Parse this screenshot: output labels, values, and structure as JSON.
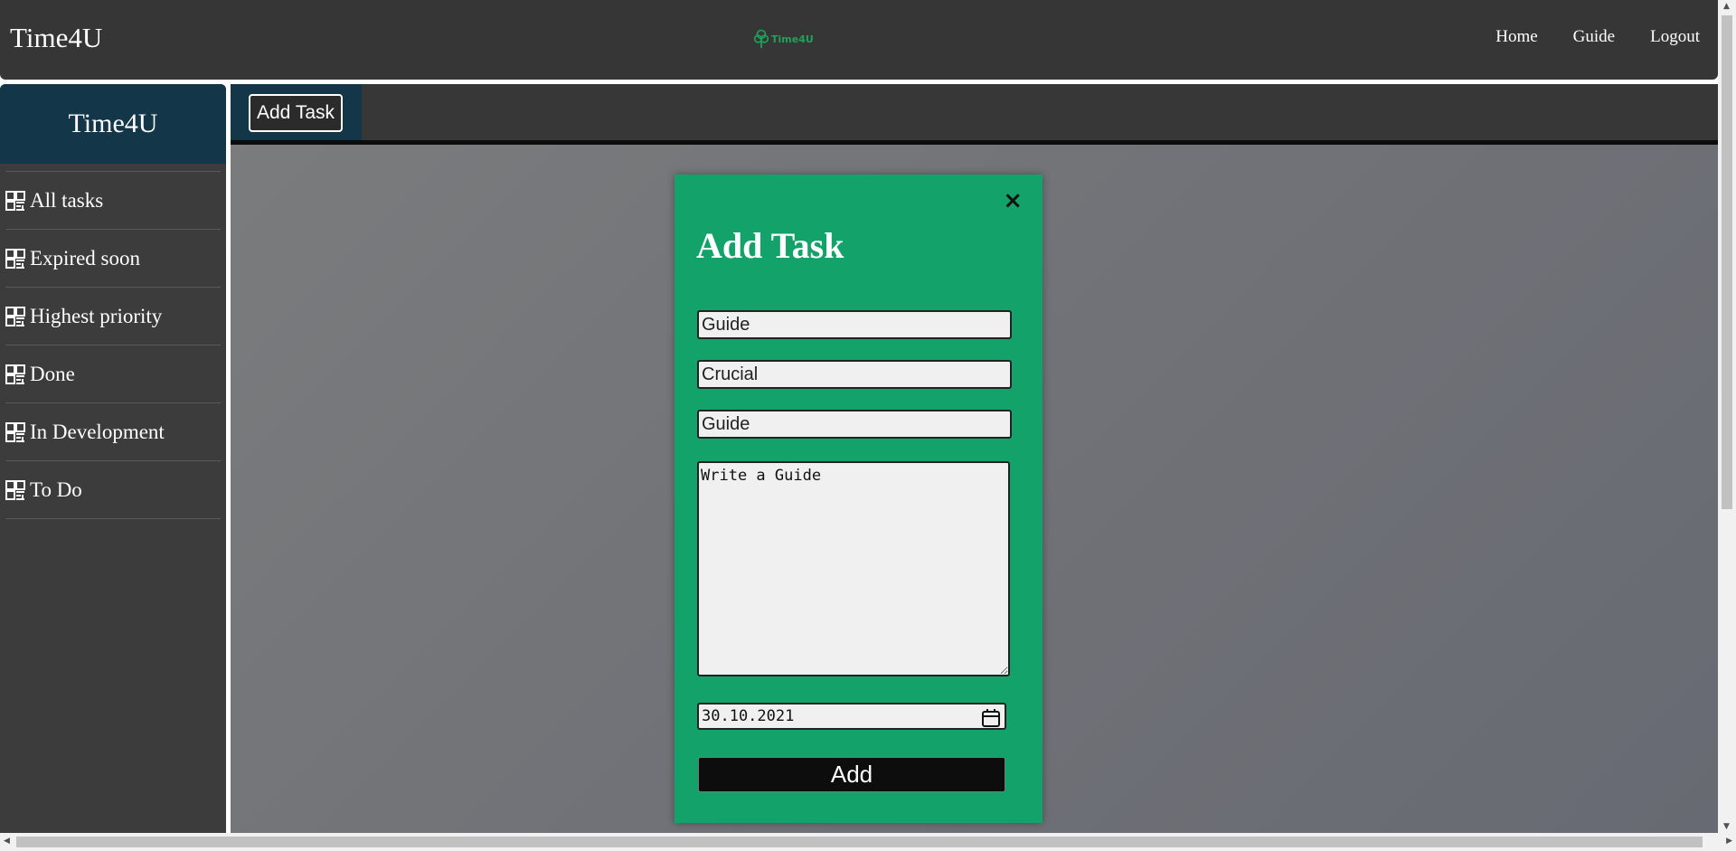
{
  "header": {
    "brand": "Time4U",
    "logo_text": "Time4U",
    "nav": [
      "Home",
      "Guide",
      "Logout"
    ]
  },
  "sidebar": {
    "title": "Time4U",
    "items": [
      {
        "label": "All tasks",
        "icon": "dashboard-icon"
      },
      {
        "label": "Expired soon",
        "icon": "dashboard-icon"
      },
      {
        "label": "Highest priority",
        "icon": "dashboard-icon"
      },
      {
        "label": "Done",
        "icon": "dashboard-icon"
      },
      {
        "label": "In Development",
        "icon": "dashboard-icon"
      },
      {
        "label": "To Do",
        "icon": "dashboard-icon"
      }
    ]
  },
  "toolbar": {
    "add_task_label": "Add Task"
  },
  "modal": {
    "close_label": "×",
    "title": "Add Task",
    "name_value": "Guide",
    "priority_value": "Crucial",
    "category_value": "Guide",
    "description_value": "Write a Guide",
    "date_value": "30.10.2021",
    "submit_label": "Add"
  },
  "colors": {
    "header_bg": "#363636",
    "sidebar_bg": "#3c3c3c",
    "accent_blue": "#133649",
    "modal_green": "#12a26a"
  }
}
